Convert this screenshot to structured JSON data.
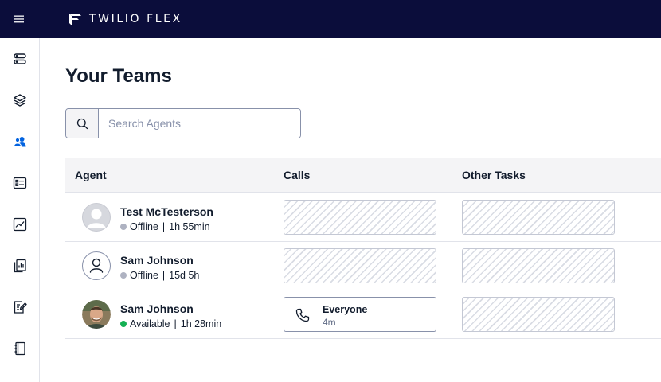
{
  "header": {
    "brand_name": "TWILIO FLEX"
  },
  "sidenav": {
    "items": [
      {
        "icon": "agent-desktop-icon",
        "active": false
      },
      {
        "icon": "layers-icon",
        "active": false
      },
      {
        "icon": "teams-icon",
        "active": true
      },
      {
        "icon": "queues-stats-icon",
        "active": false
      },
      {
        "icon": "analytics-icon",
        "active": false
      },
      {
        "icon": "reports-icon",
        "active": false
      },
      {
        "icon": "quality-edit-icon",
        "active": false
      },
      {
        "icon": "notebook-icon",
        "active": false
      }
    ]
  },
  "page": {
    "title": "Your Teams"
  },
  "search": {
    "placeholder": "Search Agents",
    "value": ""
  },
  "table": {
    "columns": [
      "Agent",
      "Calls",
      "Other Tasks"
    ],
    "rows": [
      {
        "name": "Test McTesterson",
        "status": "Offline",
        "duration": "1h 55min",
        "status_color": "#aeb2c1",
        "avatar": "default-avatar-icon",
        "calls": null,
        "other_tasks": null
      },
      {
        "name": "Sam Johnson",
        "status": "Offline",
        "duration": "15d 5h",
        "status_color": "#aeb2c1",
        "avatar": "user-outline-icon",
        "calls": null,
        "other_tasks": null
      },
      {
        "name": "Sam Johnson",
        "status": "Available",
        "duration": "1h 28min",
        "status_color": "#14b053",
        "avatar": "photo-avatar",
        "calls": {
          "queue": "Everyone",
          "time": "4m",
          "icon": "phone-icon"
        },
        "other_tasks": null
      }
    ]
  },
  "colors": {
    "header_bg": "#0b0d3b",
    "active_nav": "#0263e0",
    "text": "#121c2d",
    "muted": "#606b85"
  }
}
